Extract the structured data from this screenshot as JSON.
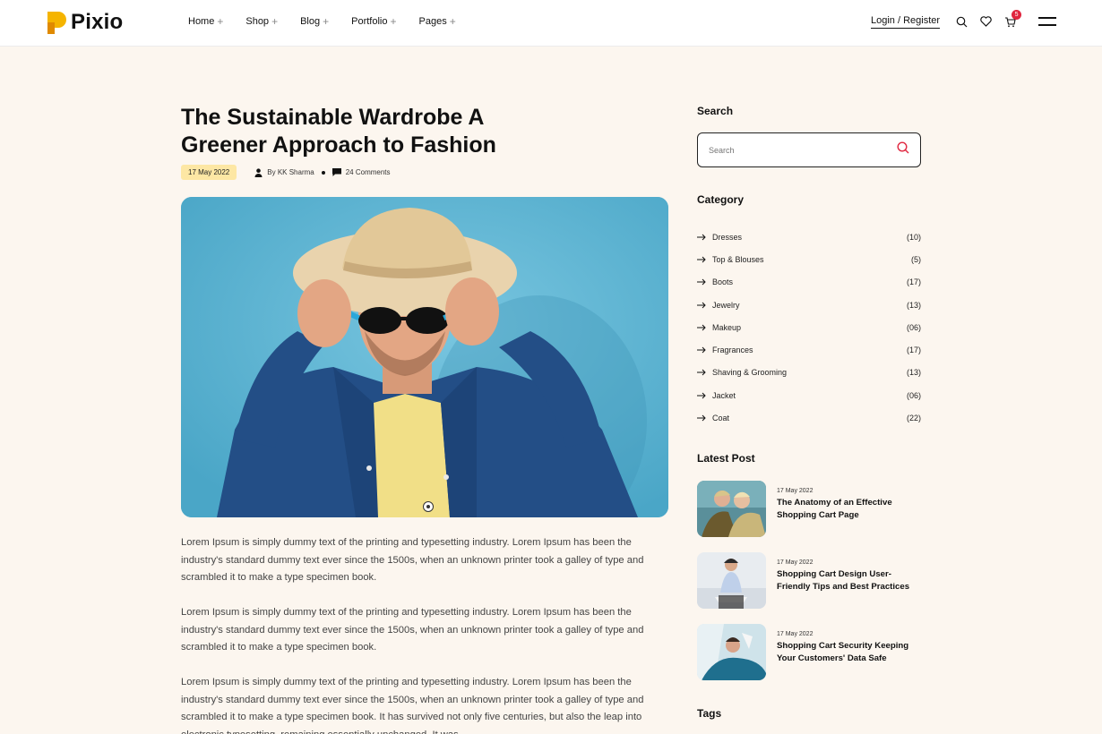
{
  "header": {
    "brand": "Pixio",
    "nav": [
      {
        "label": "Home"
      },
      {
        "label": "Shop"
      },
      {
        "label": "Blog"
      },
      {
        "label": "Portfolio"
      },
      {
        "label": "Pages"
      }
    ],
    "login": "Login / Register",
    "cart_count": "5"
  },
  "article": {
    "title": "The Sustainable Wardrobe A Greener Approach to Fashion",
    "date": "17 May 2022",
    "author": "By  KK Sharma",
    "comments": "24 Comments",
    "paragraphs": [
      "Lorem Ipsum is simply dummy text of the printing and typesetting industry. Lorem Ipsum has been the industry's standard dummy text ever since the 1500s, when an unknown printer took a galley of type and scrambled it to make a type specimen book.",
      "Lorem Ipsum is simply dummy text of the printing and typesetting industry. Lorem Ipsum has been the industry's standard dummy text ever since the 1500s, when an unknown printer took a galley of type and scrambled it to make a type specimen book.",
      "Lorem Ipsum is simply dummy text of the printing and typesetting industry. Lorem Ipsum has been the industry's standard dummy text ever since the 1500s, when an unknown printer took a galley of type and scrambled it to make a type specimen book. It has survived not only five centuries, but also the leap into electronic typesetting, remaining essentially unchanged. It was"
    ]
  },
  "sidebar": {
    "search_heading": "Search",
    "search_placeholder": "Search",
    "category_heading": "Category",
    "categories": [
      {
        "name": "Dresses",
        "count": "(10)"
      },
      {
        "name": "Top & Blouses",
        "count": "(5)"
      },
      {
        "name": "Boots",
        "count": "(17)"
      },
      {
        "name": "Jewelry",
        "count": "(13)"
      },
      {
        "name": "Makeup",
        "count": "(06)"
      },
      {
        "name": "Fragrances",
        "count": "(17)"
      },
      {
        "name": "Shaving & Grooming",
        "count": "(13)"
      },
      {
        "name": "Jacket",
        "count": "(06)"
      },
      {
        "name": "Coat",
        "count": "(22)"
      }
    ],
    "latest_heading": "Latest Post",
    "latest_posts": [
      {
        "date": "17 May 2022",
        "title": "The Anatomy of an Effective Shopping Cart Page"
      },
      {
        "date": "17 May 2022",
        "title": "Shopping Cart Design User-Friendly Tips and Best Practices"
      },
      {
        "date": "17 May 2022",
        "title": "Shopping Cart Security Keeping Your Customers' Data Safe"
      }
    ],
    "tags_heading": "Tags"
  },
  "colors": {
    "background": "#fcf6ef",
    "brand_yellow": "#f5b400",
    "date_badge": "#fde7a4",
    "badge_red": "#e0263f",
    "search_icon": "#e0263f"
  }
}
